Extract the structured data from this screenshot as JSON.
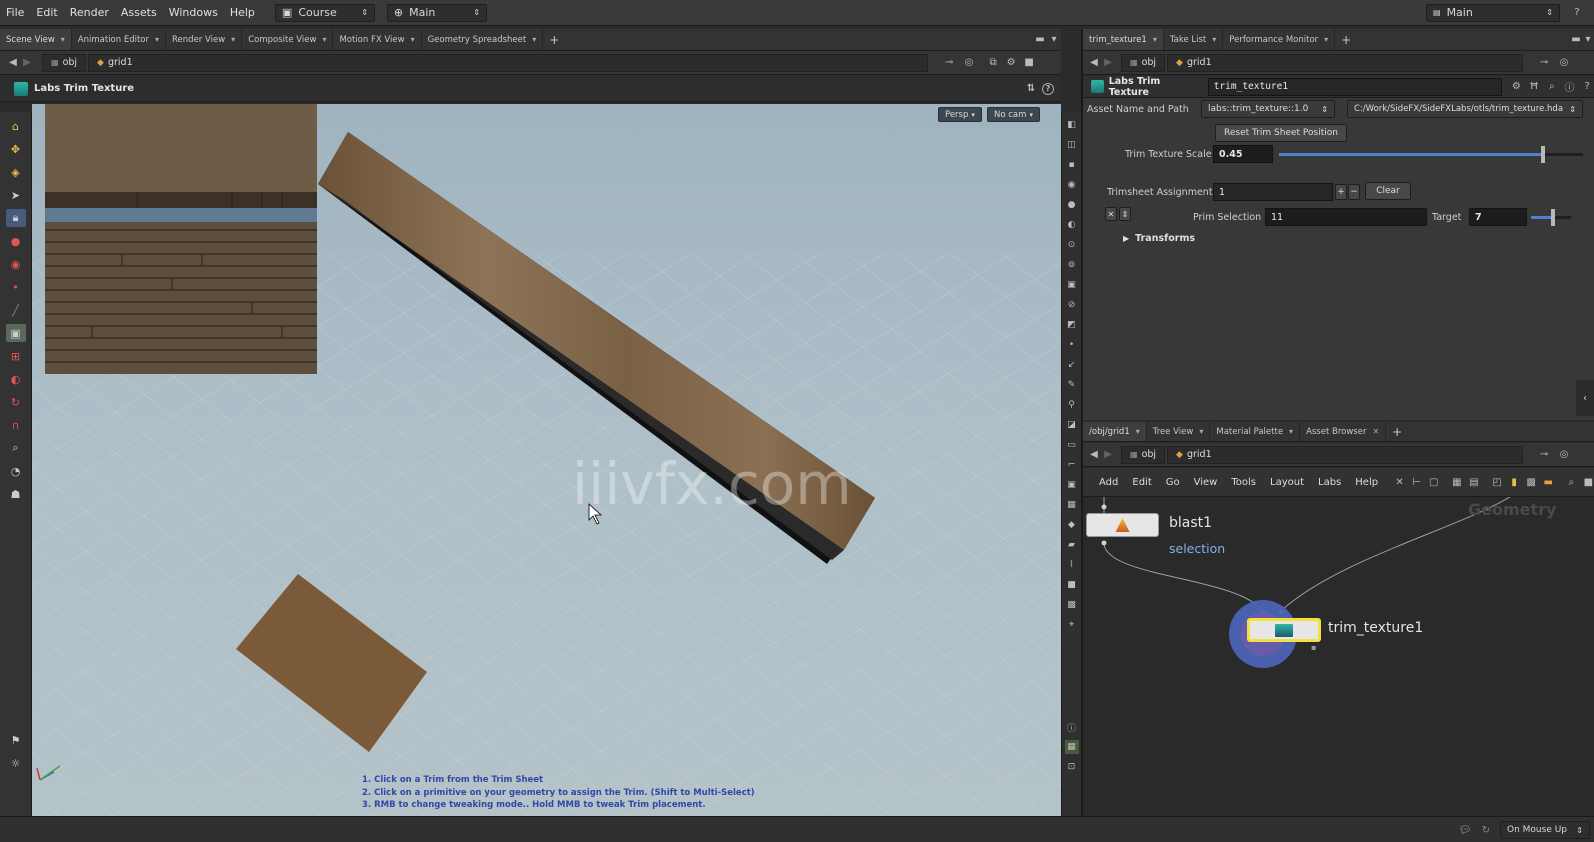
{
  "menubar": {
    "items": [
      "File",
      "Edit",
      "Render",
      "Assets",
      "Windows",
      "Help"
    ],
    "desktop": "Course",
    "context": "Main",
    "right_context": "Main"
  },
  "left_pane": {
    "tabs": [
      "Scene View",
      "Animation Editor",
      "Render View",
      "Composite View",
      "Motion FX View",
      "Geometry Spreadsheet"
    ],
    "path_root": "obj",
    "path_node": "grid1",
    "tool_title": "Labs Trim Texture",
    "viewport": {
      "camera_menu": "Persp",
      "cam_menu": "No cam",
      "instructions": [
        "1. Click on a Trim from the Trim Sheet",
        "2. Click on a primitive on your geometry to assign the Trim. (Shift to Multi-Select)",
        "3. RMB to change tweaking mode.. Hold MMB to tweak Trim placement."
      ],
      "watermark": "iiivfx.com"
    }
  },
  "param_pane": {
    "tabs": [
      "trim_texture1",
      "Take List",
      "Performance Monitor"
    ],
    "path_root": "obj",
    "path_node": "grid1",
    "node_type": "Labs Trim Texture",
    "node_name": "trim_texture1",
    "asset_label": "Asset Name and Path",
    "asset_name": "labs::trim_texture::1.0",
    "asset_path": "C:/Work/SideFX/SideFXLabs/otls/trim_texture.hda",
    "reset_button": "Reset Trim Sheet Position",
    "scale_label": "Trim Texture Scale",
    "scale_value": "0.45",
    "scale_fraction": 0.87,
    "assign_label": "Trimsheet Assignments",
    "assign_value": "1",
    "clear_button": "Clear",
    "prim_label": "Prim Selection",
    "prim_value": "11",
    "target_label": "Target",
    "target_value": "7",
    "target_fraction": 0.55,
    "transforms_label": "Transforms"
  },
  "network_pane": {
    "tabs": [
      "/obj/grid1",
      "Tree View",
      "Material Palette",
      "Asset Browser"
    ],
    "path_root": "obj",
    "path_node": "grid1",
    "menu": [
      "Add",
      "Edit",
      "Go",
      "View",
      "Tools",
      "Layout",
      "Labs",
      "Help"
    ],
    "context_label": "Geometry",
    "nodes": [
      {
        "name": "blast1",
        "sub": "selection"
      },
      {
        "name": "trim_texture1",
        "sub": ""
      }
    ]
  },
  "statusbar": {
    "update_mode": "On Mouse Up"
  },
  "colors": {
    "accent_blue": "#4f7fd0",
    "node_selected": "#f2e23c",
    "trim_ring": "#4b63b5",
    "wood_plank": "#7a5c3c",
    "floor_plate": "#7b5a3a"
  }
}
